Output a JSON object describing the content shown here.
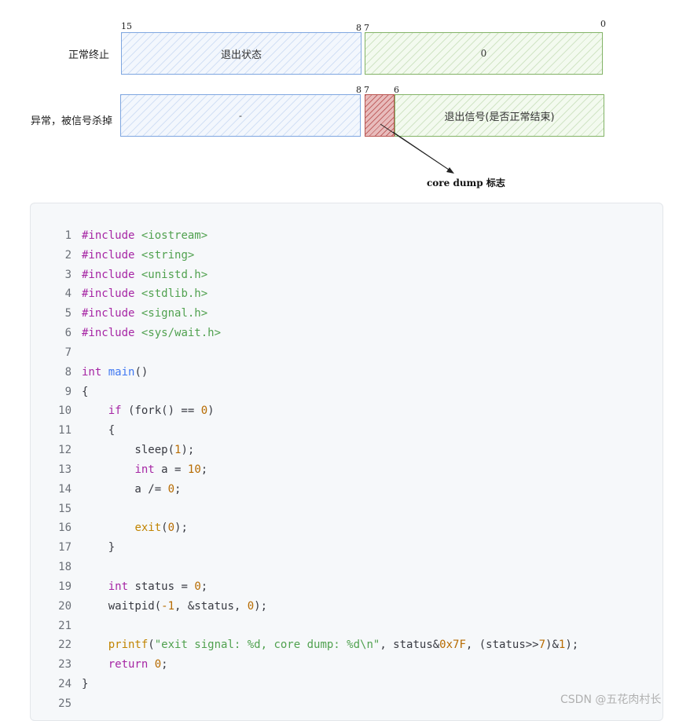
{
  "diagram": {
    "row1_label": "正常终止",
    "row2_label": "异常，被信号杀掉",
    "exit_status_box": "退出状态",
    "zero_box": "0",
    "dash_box": "-",
    "signal_box": "退出信号(是否正常结束)",
    "core_dump_label": "core dump 标志",
    "bits": {
      "b15": "15",
      "b8": "8",
      "b7": "7",
      "b0": "0",
      "b6": "6"
    },
    "colors": {
      "blue_border": "#7ea6e0",
      "green_border": "#82b366",
      "red_border": "#b85450"
    }
  },
  "code": {
    "language": "cpp",
    "lines": [
      {
        "n": "1",
        "tokens": [
          {
            "t": "#include",
            "c": "kw"
          },
          {
            "t": " ",
            "c": ""
          },
          {
            "t": "<iostream>",
            "c": "str"
          }
        ]
      },
      {
        "n": "2",
        "tokens": [
          {
            "t": "#include",
            "c": "kw"
          },
          {
            "t": " ",
            "c": ""
          },
          {
            "t": "<string>",
            "c": "str"
          }
        ]
      },
      {
        "n": "3",
        "tokens": [
          {
            "t": "#include",
            "c": "kw"
          },
          {
            "t": " ",
            "c": ""
          },
          {
            "t": "<unistd.h>",
            "c": "str"
          }
        ]
      },
      {
        "n": "4",
        "tokens": [
          {
            "t": "#include",
            "c": "kw"
          },
          {
            "t": " ",
            "c": ""
          },
          {
            "t": "<stdlib.h>",
            "c": "str"
          }
        ]
      },
      {
        "n": "5",
        "tokens": [
          {
            "t": "#include",
            "c": "kw"
          },
          {
            "t": " ",
            "c": ""
          },
          {
            "t": "<signal.h>",
            "c": "str"
          }
        ]
      },
      {
        "n": "6",
        "tokens": [
          {
            "t": "#include",
            "c": "kw"
          },
          {
            "t": " ",
            "c": ""
          },
          {
            "t": "<sys/wait.h>",
            "c": "str"
          }
        ]
      },
      {
        "n": "7",
        "tokens": []
      },
      {
        "n": "8",
        "tokens": [
          {
            "t": "int",
            "c": "type"
          },
          {
            "t": " ",
            "c": ""
          },
          {
            "t": "main",
            "c": "fn"
          },
          {
            "t": "()",
            "c": ""
          }
        ]
      },
      {
        "n": "9",
        "tokens": [
          {
            "t": "{",
            "c": ""
          }
        ]
      },
      {
        "n": "10",
        "tokens": [
          {
            "t": "    ",
            "c": ""
          },
          {
            "t": "if",
            "c": "kw"
          },
          {
            "t": " (fork() == ",
            "c": ""
          },
          {
            "t": "0",
            "c": "num"
          },
          {
            "t": ")",
            "c": ""
          }
        ]
      },
      {
        "n": "11",
        "tokens": [
          {
            "t": "    {",
            "c": ""
          }
        ]
      },
      {
        "n": "12",
        "tokens": [
          {
            "t": "        sleep(",
            "c": ""
          },
          {
            "t": "1",
            "c": "num"
          },
          {
            "t": ");",
            "c": ""
          }
        ]
      },
      {
        "n": "13",
        "tokens": [
          {
            "t": "        ",
            "c": ""
          },
          {
            "t": "int",
            "c": "type"
          },
          {
            "t": " a = ",
            "c": ""
          },
          {
            "t": "10",
            "c": "num"
          },
          {
            "t": ";",
            "c": ""
          }
        ]
      },
      {
        "n": "14",
        "tokens": [
          {
            "t": "        a /= ",
            "c": ""
          },
          {
            "t": "0",
            "c": "num"
          },
          {
            "t": ";",
            "c": ""
          }
        ]
      },
      {
        "n": "15",
        "tokens": []
      },
      {
        "n": "16",
        "tokens": [
          {
            "t": "        ",
            "c": ""
          },
          {
            "t": "exit",
            "c": "call"
          },
          {
            "t": "(",
            "c": ""
          },
          {
            "t": "0",
            "c": "num"
          },
          {
            "t": ");",
            "c": ""
          }
        ]
      },
      {
        "n": "17",
        "tokens": [
          {
            "t": "    }",
            "c": ""
          }
        ]
      },
      {
        "n": "18",
        "tokens": []
      },
      {
        "n": "19",
        "tokens": [
          {
            "t": "    ",
            "c": ""
          },
          {
            "t": "int",
            "c": "type"
          },
          {
            "t": " status = ",
            "c": ""
          },
          {
            "t": "0",
            "c": "num"
          },
          {
            "t": ";",
            "c": ""
          }
        ]
      },
      {
        "n": "20",
        "tokens": [
          {
            "t": "    waitpid(",
            "c": ""
          },
          {
            "t": "-1",
            "c": "num"
          },
          {
            "t": ", &status, ",
            "c": ""
          },
          {
            "t": "0",
            "c": "num"
          },
          {
            "t": ");",
            "c": ""
          }
        ]
      },
      {
        "n": "21",
        "tokens": []
      },
      {
        "n": "22",
        "tokens": [
          {
            "t": "    ",
            "c": ""
          },
          {
            "t": "printf",
            "c": "call"
          },
          {
            "t": "(",
            "c": ""
          },
          {
            "t": "\"exit signal: %d, core dump: %d\\n\"",
            "c": "str"
          },
          {
            "t": ", status&",
            "c": ""
          },
          {
            "t": "0x7F",
            "c": "num"
          },
          {
            "t": ", (status>>",
            "c": ""
          },
          {
            "t": "7",
            "c": "num"
          },
          {
            "t": ")&",
            "c": ""
          },
          {
            "t": "1",
            "c": "num"
          },
          {
            "t": ");",
            "c": ""
          }
        ]
      },
      {
        "n": "23",
        "tokens": [
          {
            "t": "    ",
            "c": ""
          },
          {
            "t": "return",
            "c": "kw"
          },
          {
            "t": " ",
            "c": ""
          },
          {
            "t": "0",
            "c": "num"
          },
          {
            "t": ";",
            "c": ""
          }
        ]
      },
      {
        "n": "24",
        "tokens": [
          {
            "t": "}",
            "c": ""
          }
        ]
      },
      {
        "n": "25",
        "tokens": []
      }
    ]
  },
  "watermark": "CSDN @五花肉村长"
}
